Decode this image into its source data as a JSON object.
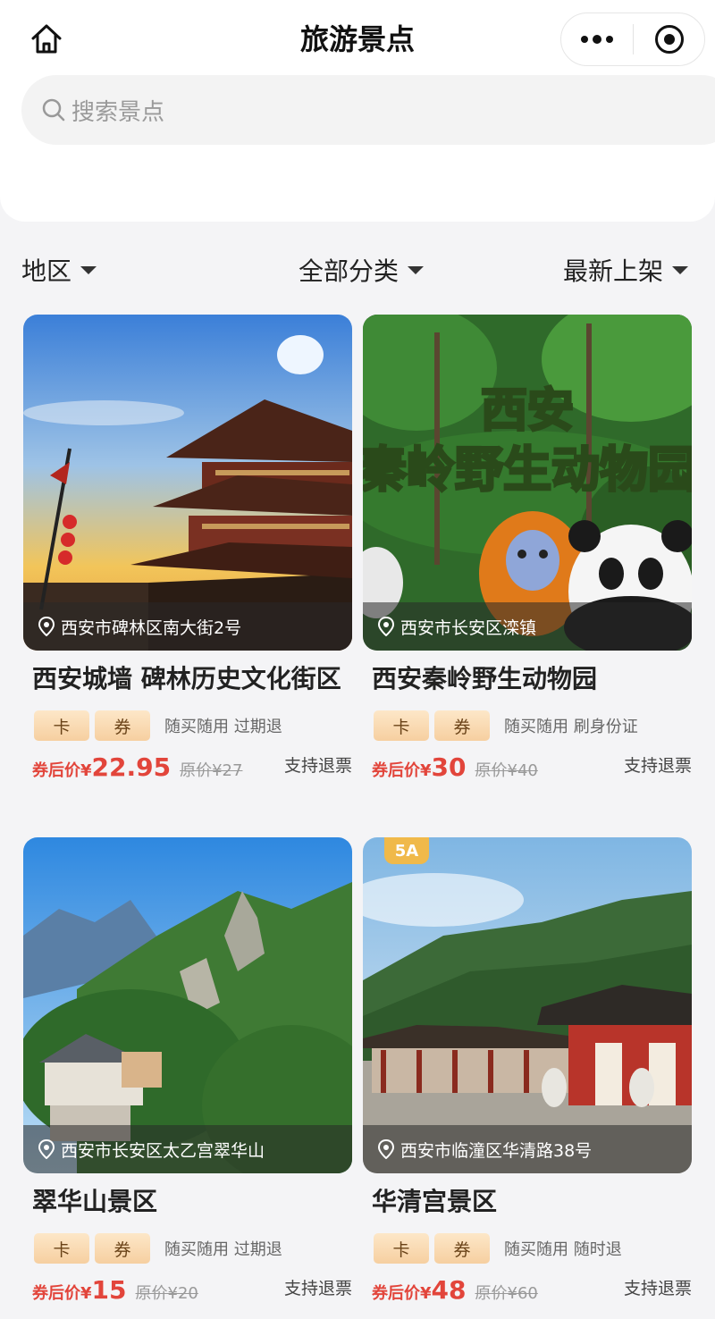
{
  "header": {
    "title": "旅游景点",
    "search_placeholder": "搜索景点"
  },
  "filters": {
    "region": "地区",
    "category": "全部分类",
    "sort": "最新上架"
  },
  "cards": [
    {
      "location": "西安市碑林区南大街2号",
      "name": "西安城墙 碑林历史文化街区",
      "tags": [
        "卡",
        "券"
      ],
      "note": "随买随用 过期退",
      "price_prefix": "券后价¥",
      "price": "22.95",
      "original_price": "原价¥27",
      "refund": "支持退票"
    },
    {
      "location": "西安市长安区滦镇",
      "name": "西安秦岭野生动物园",
      "image_text": [
        "西安",
        "秦岭野生动物园"
      ],
      "tags": [
        "卡",
        "券"
      ],
      "note": "随买随用 刷身份证",
      "price_prefix": "券后价¥",
      "price": "30",
      "original_price": "原价¥40",
      "refund": "支持退票"
    },
    {
      "location": "西安市长安区太乙宫翠华山",
      "name": "翠华山景区",
      "tags": [
        "卡",
        "券"
      ],
      "note": "随买随用 过期退",
      "price_prefix": "券后价¥",
      "price": "15",
      "original_price": "原价¥20",
      "refund": "支持退票"
    },
    {
      "location": "西安市临潼区华清路38号",
      "name": "华清宫景区",
      "badge": "5A",
      "tags": [
        "卡",
        "券"
      ],
      "note": "随买随用 随时退",
      "price_prefix": "券后价¥",
      "price": "48",
      "original_price": "原价¥60",
      "refund": "支持退票"
    }
  ]
}
